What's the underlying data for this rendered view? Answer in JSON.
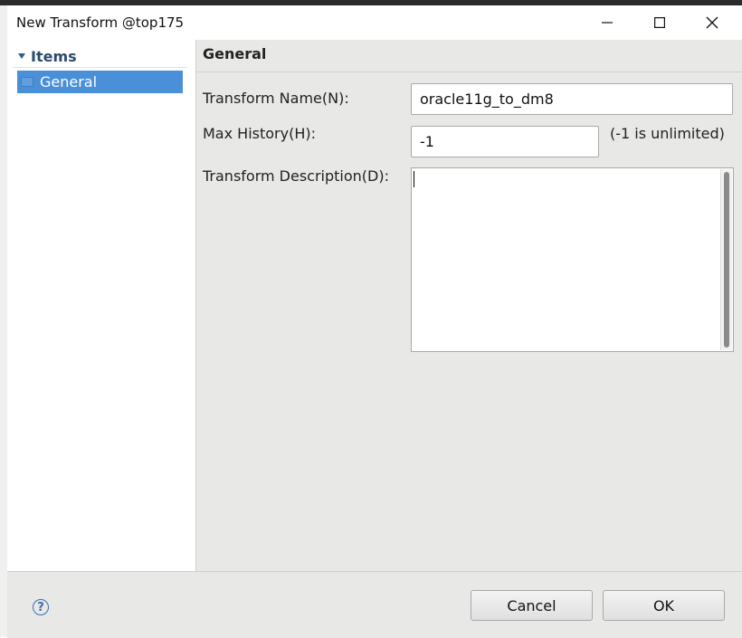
{
  "window": {
    "title": "New Transform @top175",
    "minimize_icon": "minimize-icon",
    "maximize_icon": "maximize-icon",
    "close_icon": "close-icon"
  },
  "tree": {
    "header_label": "Items",
    "items": [
      {
        "label": "General",
        "selected": true
      }
    ]
  },
  "page": {
    "header": "General",
    "fields": {
      "name_label": "Transform Name(N):",
      "name_value": "oracle11g_to_dm8",
      "history_label": "Max History(H):",
      "history_value": "-1",
      "history_hint": "(-1 is unlimited)",
      "description_label": "Transform Description(D):",
      "description_value": ""
    }
  },
  "footer": {
    "help_icon": "help-icon",
    "cancel_label": "Cancel",
    "ok_label": "OK"
  },
  "colors": {
    "selection": "#4a90d9",
    "panel_bg": "#e8e8e7",
    "tree_header_text": "#2a4a6f"
  }
}
